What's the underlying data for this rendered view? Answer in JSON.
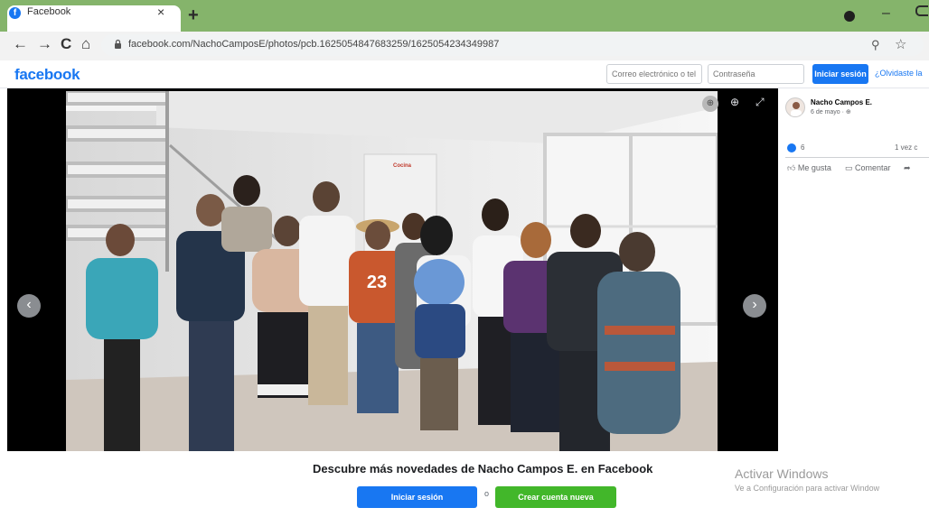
{
  "browser": {
    "tab_title": "Facebook",
    "tab_close": "×",
    "new_tab": "+",
    "url": "facebook.com/NachoCamposE/photos/pcb.1625054847683259/1625054234349987",
    "nav_back": "←",
    "nav_forward": "→",
    "nav_reload": "C",
    "nav_home": "⌂",
    "window_minimize": "–"
  },
  "header": {
    "logo": "facebook",
    "email_placeholder": "Correo electrónico o tel",
    "password_placeholder": "Contraseña",
    "login_label": "Iniciar sesión",
    "forgot_label": "¿Olvidaste la"
  },
  "viewer": {
    "prev_label": "‹",
    "next_label": "›"
  },
  "post": {
    "author": "Nacho Campos E.",
    "date": "6 de mayo · ⊕",
    "reaction_count": "6",
    "share_count": "1 vez c",
    "actions": {
      "like": "Me gusta",
      "comment": "Comentar"
    },
    "photo_text": {
      "sign": "Cocina",
      "shirt_number": "23"
    }
  },
  "footer": {
    "discover_text": "Descubre más novedades de Nacho Campos E. en Facebook",
    "login_label": "Iniciar sesión",
    "or_label": "o",
    "create_label": "Crear cuenta nueva"
  },
  "windows_watermark": {
    "title": "Activar Windows",
    "subtitle": "Ve a Configuración para activar Window"
  },
  "colors": {
    "chrome_green": "#85b46b",
    "facebook_blue": "#1877f2",
    "create_green": "#42b72a"
  }
}
